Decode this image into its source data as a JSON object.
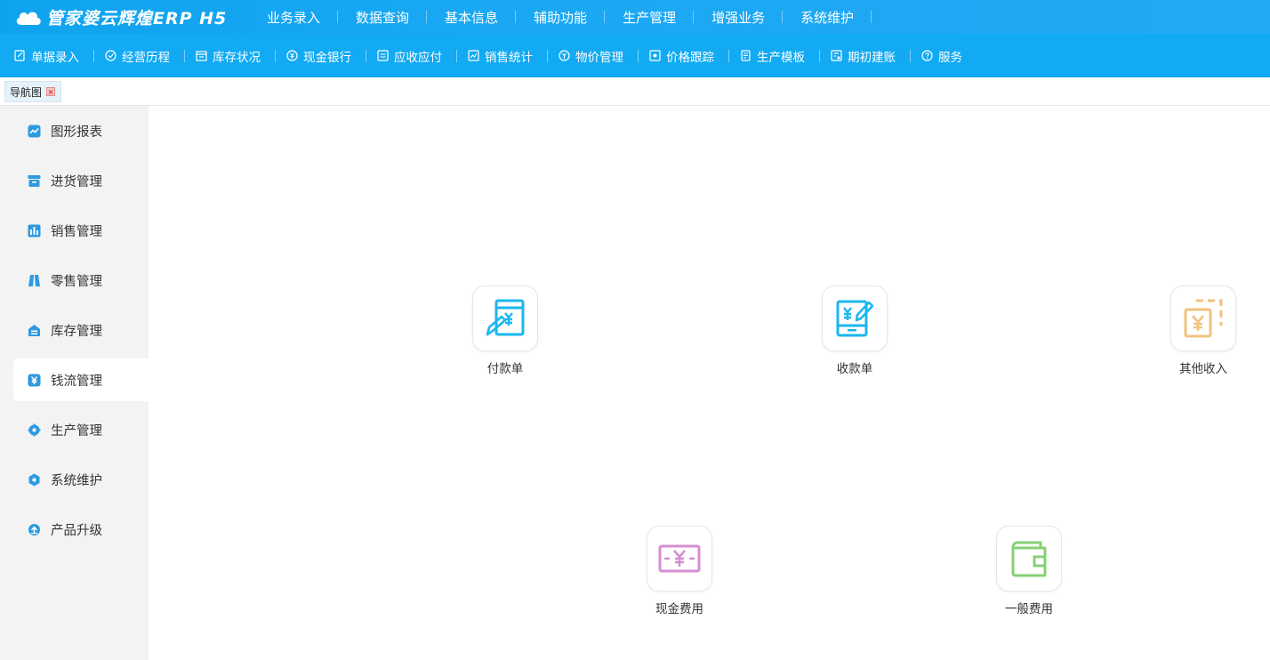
{
  "app": {
    "logo_text": "管家婆云辉煌ERP H5"
  },
  "topnav": {
    "items": [
      "业务录入",
      "数据查询",
      "基本信息",
      "辅助功能",
      "生产管理",
      "增强业务",
      "系统维护"
    ]
  },
  "toolbar": {
    "items": [
      {
        "label": "单据录入",
        "icon": "edit-doc-icon"
      },
      {
        "label": "经营历程",
        "icon": "check-circle-icon"
      },
      {
        "label": "库存状况",
        "icon": "warehouse-icon"
      },
      {
        "label": "现金银行",
        "icon": "yen-circle-icon"
      },
      {
        "label": "应收应付",
        "icon": "exchange-icon"
      },
      {
        "label": "销售统计",
        "icon": "chart-icon"
      },
      {
        "label": "物价管理",
        "icon": "price-icon"
      },
      {
        "label": "价格跟踪",
        "icon": "tracking-icon"
      },
      {
        "label": "生产模板",
        "icon": "template-icon"
      },
      {
        "label": "期初建账",
        "icon": "ledger-icon"
      },
      {
        "label": "服务",
        "icon": "help-icon"
      }
    ]
  },
  "tabs": {
    "items": [
      {
        "label": "导航图"
      }
    ]
  },
  "sidebar": {
    "items": [
      {
        "label": "图形报表",
        "icon": "line-chart-icon",
        "active": false
      },
      {
        "label": "进货管理",
        "icon": "box-icon",
        "active": false
      },
      {
        "label": "销售管理",
        "icon": "bar-chart-icon",
        "active": false
      },
      {
        "label": "零售管理",
        "icon": "shopping-bag-icon",
        "active": false
      },
      {
        "label": "库存管理",
        "icon": "storage-icon",
        "active": false
      },
      {
        "label": "钱流管理",
        "icon": "yen-icon",
        "active": true
      },
      {
        "label": "生产管理",
        "icon": "gear-icon",
        "active": false
      },
      {
        "label": "系统维护",
        "icon": "hexagon-icon",
        "active": false
      },
      {
        "label": "产品升级",
        "icon": "upgrade-icon",
        "active": false
      }
    ]
  },
  "main": {
    "tiles": [
      {
        "label": "付款单",
        "icon": "payment-voucher-icon",
        "color": "#1bb7ee"
      },
      {
        "label": "收款单",
        "icon": "receipt-voucher-icon",
        "color": "#1bb7ee"
      },
      {
        "label": "其他收入",
        "icon": "other-income-icon",
        "color": "#f2c27e"
      },
      {
        "label": "现金费用",
        "icon": "cash-expense-icon",
        "color": "#d58ed0"
      },
      {
        "label": "一般费用",
        "icon": "general-expense-icon",
        "color": "#86d076"
      }
    ]
  },
  "colors": {
    "topbar": "#1aa8f3",
    "toolbar": "#11aaf3",
    "sidebar_icon": "#2d9ae0",
    "sidebar_bg": "#f3f3f3"
  }
}
